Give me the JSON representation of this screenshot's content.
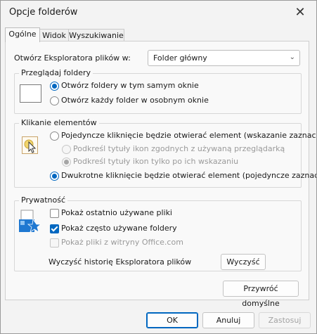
{
  "window": {
    "title": "Opcje folderów"
  },
  "tabs": [
    {
      "label": "Ogólne"
    },
    {
      "label": "Widok"
    },
    {
      "label": "Wyszukiwanie"
    }
  ],
  "open_explorer": {
    "label": "Otwórz Eksploratora plików w:",
    "value": "Folder główny"
  },
  "browse": {
    "title": "Przeglądaj foldery",
    "options": [
      "Otwórz foldery w tym samym oknie",
      "Otwórz każdy folder w osobnym oknie"
    ],
    "selected": 0
  },
  "click": {
    "title": "Klikanie elementów",
    "single": "Pojedyncze kliknięcie będzie otwierać element (wskazanie zaznaczy)",
    "underline_browser": "Podkreśl tytuły ikon zgodnych z używaną przeglądarką",
    "underline_hover": "Podkreśl tytuły ikon tylko po ich wskazaniu",
    "double": "Dwukrotne kliknięcie będzie otwierać element (pojedyncze zaznaczy)"
  },
  "privacy": {
    "title": "Prywatność",
    "recent_files": "Pokaż ostatnio używane pliki",
    "frequent_folders": "Pokaż często używane foldery",
    "office_files": "Pokaż pliki z witryny Office.com",
    "clear_label": "Wyczyść historię Eksploratora plików",
    "clear_button": "Wyczyść"
  },
  "restore_defaults": "Przywróć domyślne",
  "footer": {
    "ok": "OK",
    "cancel": "Anuluj",
    "apply": "Zastosuj"
  },
  "colors": {
    "accent": "#0067c0",
    "window_bg": "#f3f3f3",
    "panel_bg": "#f9f9f9"
  }
}
